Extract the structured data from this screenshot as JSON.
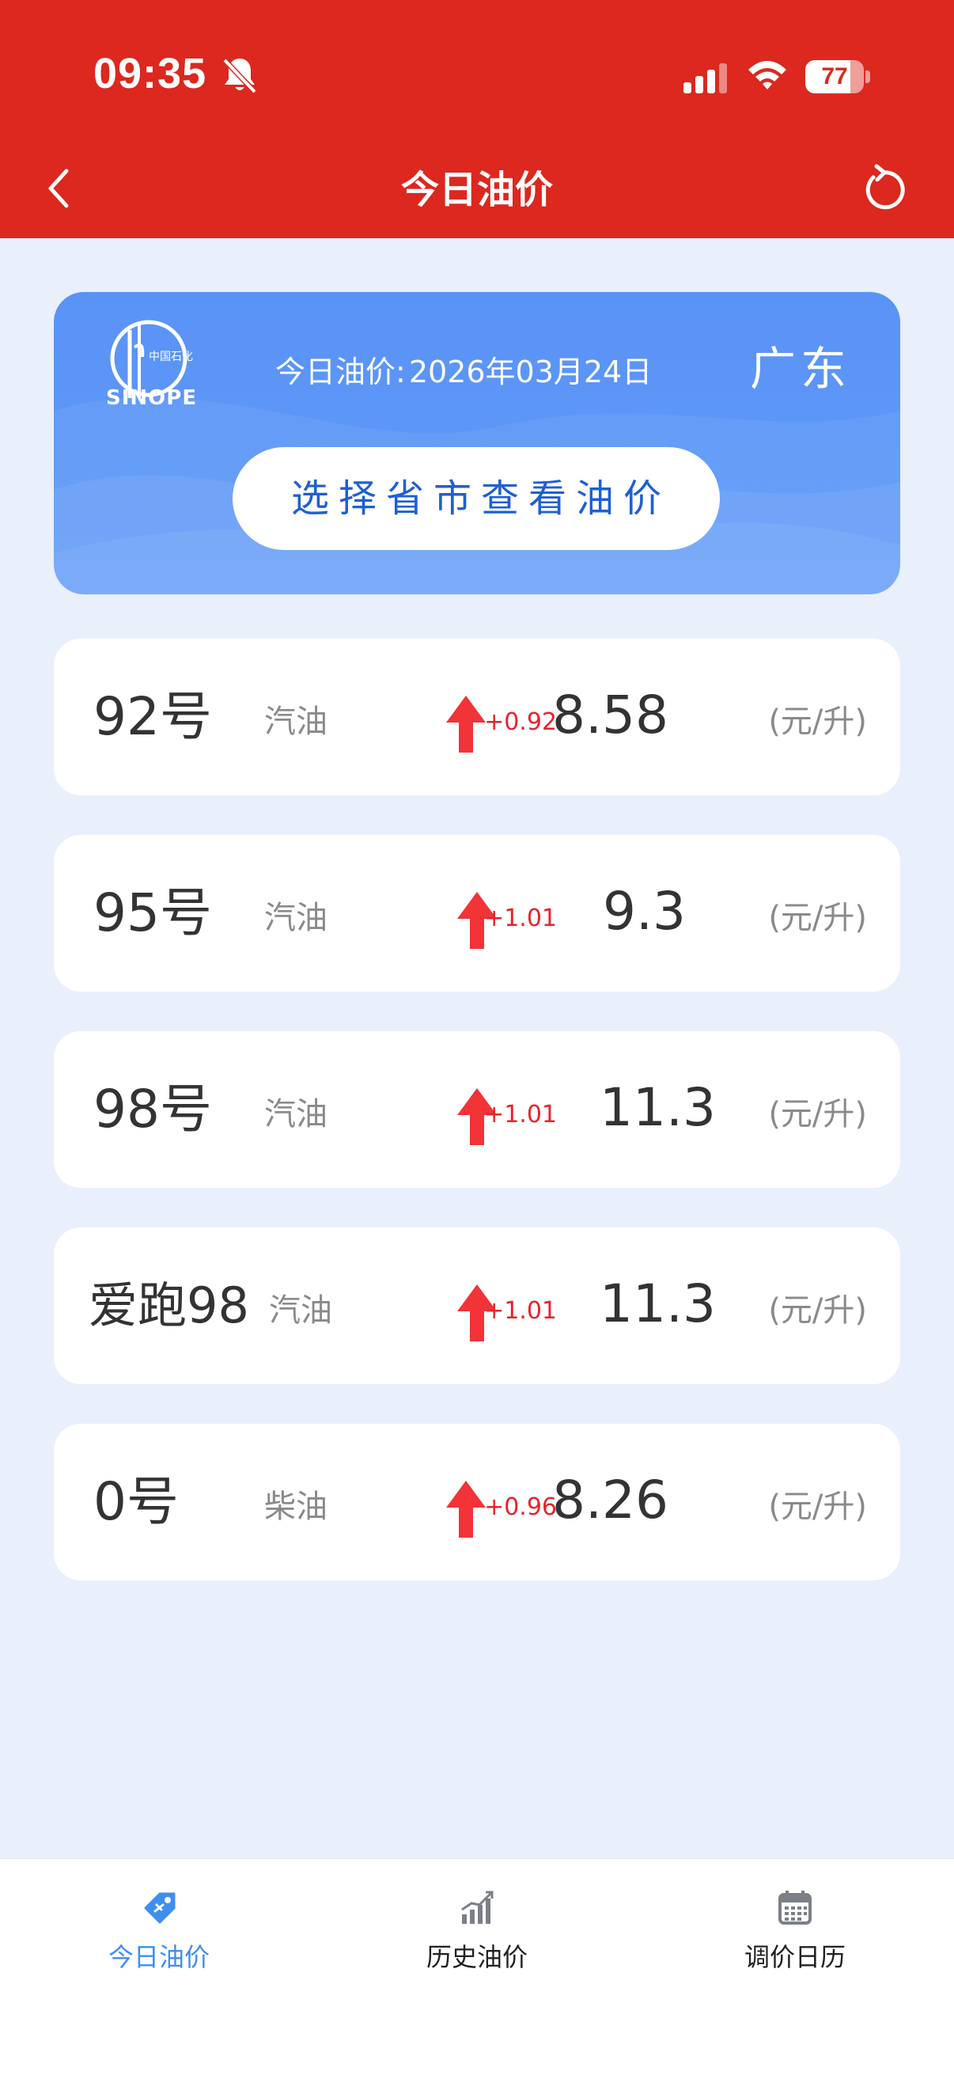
{
  "status_bar": {
    "time": "09:35",
    "battery": "77",
    "battery_level": 0.77,
    "icons": [
      "bell-slash-icon",
      "signal-icon",
      "wifi-icon",
      "battery-icon"
    ]
  },
  "nav": {
    "title": "今日油价",
    "back_icon": "chevron-left-icon",
    "refresh_icon": "refresh-icon"
  },
  "banner": {
    "logo": "sinopec-logo",
    "date_label": "今日油价:",
    "date": "2026年03月24日",
    "province": "广东",
    "select_button": "选择省市查看油价"
  },
  "prices": [
    {
      "grade": "92号",
      "type": "汽油",
      "change": "+0.92",
      "price": "8.58",
      "unit": "(元/升)"
    },
    {
      "grade": "95号",
      "type": "汽油",
      "change": "+1.01",
      "price": "9.3",
      "unit": "(元/升)"
    },
    {
      "grade": "98号",
      "type": "汽油",
      "change": "+1.01",
      "price": "11.3",
      "unit": "(元/升)"
    },
    {
      "grade": "爱跑98",
      "type": "汽油",
      "change": "+1.01",
      "price": "11.3",
      "unit": "(元/升)"
    },
    {
      "grade": "0号",
      "type": "柴油",
      "change": "+0.96",
      "price": "8.26",
      "unit": "(元/升)"
    }
  ],
  "colors": {
    "header": "#dc281e",
    "banner": "#5a93f6",
    "up_arrow": "#f23337",
    "active_tab": "#3e8ef0",
    "background": "#e9f0fb"
  },
  "tabs": [
    {
      "label": "今日油价",
      "icon": "price-tag-icon",
      "active": true
    },
    {
      "label": "历史油价",
      "icon": "bar-chart-icon",
      "active": false
    },
    {
      "label": "调价日历",
      "icon": "calendar-icon",
      "active": false
    }
  ]
}
